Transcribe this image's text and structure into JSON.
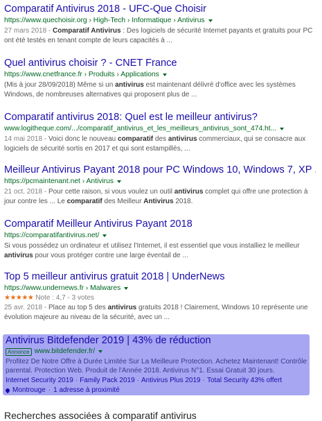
{
  "results": [
    {
      "title": "Comparatif Antivirus 2018 - UFC-Que Choisir",
      "url": "https://www.quechoisir.org › High-Tech › Informatique › Antivirus",
      "snippet_html": "<span class=\"date\">27 mars 2018 - </span><b>Comparatif Antivirus</b> : Des logiciels de sécurité Internet payants et gratuits pour PC ont été testés en tenant compte de leurs capacités à ..."
    },
    {
      "title": "Quel antivirus choisir ? - CNET France",
      "url": "https://www.cnetfrance.fr › Produits › Applications",
      "snippet_html": "(Mis à jour 28/09/2018) Même si un <b>antivirus</b> est maintenant délivré d'office avec les systèmes Windows, de nombreuses alternatives qui proposent plus de ..."
    },
    {
      "title": "Comparatif antivirus 2018: Quel est le meilleur antivirus?",
      "url": "www.logitheque.com/.../comparatif_antivirus_et_les_meilleurs_antivirus_sont_474.ht...",
      "snippet_html": "<span class=\"date\">14 mai 2018 - </span>Voici donc le nouveau <b>comparatif</b> des <b>antivirus</b> commerciaux, qui se consacre aux logiciels de sécurité sortis en 2017 et qui sont estampillés, ..."
    },
    {
      "title": "Meilleur Antivirus Payant 2018 pour PC Windows 10, Windows 7, XP ...",
      "url": "https://pcmaintenant.net › Antivirus",
      "snippet_html": "<span class=\"date\">21 oct. 2018 - </span>Pour cette raison, si vous voulez un outil <b>antivirus</b> complet qui offre une protection à jour contre les ... Le <b>comparatif</b> des Meilleur <b>Antivirus</b> 2018."
    },
    {
      "title": "Comparatif Meilleur Antivirus Payant 2018",
      "url": "https://comparatifantivirus.net/",
      "snippet_html": "Si vous possédez un ordinateur et utilisez l'Internet, il est essentiel que vous installiez le meilleur <b>antivirus</b> pour vous protéger contre une large éventail de ..."
    },
    {
      "title": "Top 5 meilleur antivirus gratuit 2018 | UnderNews",
      "url": "https://www.undernews.fr › Malwares",
      "rating": {
        "stars": "★★★★★",
        "text": "Note : 4,7 - 3 votes",
        "value": 4.7
      },
      "snippet_html": "<span class=\"date\">25 avr. 2018 - </span>Place au top 5 des <b>antivirus</b> gratuits 2018 ! Clairement, Windows 10 représente une évolution majeure au niveau de la sécurité, avec un ..."
    }
  ],
  "ad": {
    "title": "Antivirus Bitdefender 2019 | 43% de réduction",
    "badge": "Annonce",
    "url": "www.bitdefender.fr/",
    "snippet": "Profitez De Notre Offre à Durée Limitée Sur La Meilleure Protection. Achetez Maintenant! Contrôle parental. Protection Web. Produit de l'Année 2018. Antivirus N°1. Essai Gratuit 30 jours.",
    "sitelinks": [
      "Internet Security 2019",
      "Family Pack 2019",
      "Antivirus Plus 2019",
      "Total Security 43% offert"
    ],
    "location": "Montrouge",
    "location_extra": "1 adresse à proximité"
  },
  "related_title": "Recherches associées à comparatif antivirus"
}
